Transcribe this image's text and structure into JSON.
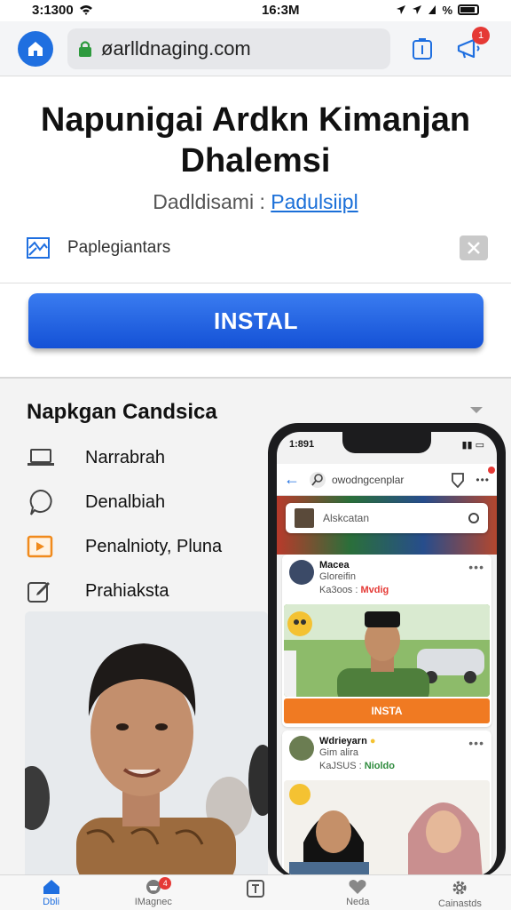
{
  "status_bar": {
    "left_text": "3:1300",
    "time": "16:3M",
    "battery_text": "%"
  },
  "browser": {
    "url": "øarlldnaging.com",
    "notification_count": "1"
  },
  "app": {
    "title": "Napunigai Ardkn Kimanjan Dhalemsi",
    "developer_label": "Dadldisami :",
    "developer_link": "Padulsiipl",
    "ad_label": "Paplegiantars",
    "install_label": "INSTAL"
  },
  "features": {
    "title": "Napkgan Candsica",
    "items": [
      {
        "label": "Narrabrah",
        "icon": "laptop-icon"
      },
      {
        "label": "Denalbiah",
        "icon": "chat-bubble-icon"
      },
      {
        "label": "Penalnioty, Pluna",
        "icon": "play-icon"
      },
      {
        "label": "Prahiaksta",
        "icon": "edit-icon"
      }
    ]
  },
  "phone": {
    "status_time": "1:891",
    "nav_url": "owodngcenplar",
    "search_text": "Alskcatan",
    "posts": [
      {
        "name": "Macea",
        "sub": "Gloreifin",
        "stat": "Ka3oos :",
        "tag": "Mvdig",
        "install_label": "INSTA"
      },
      {
        "name": "Wdrieyarn",
        "sub": "Gim alira",
        "stat": "KaJSUS :",
        "tag": "Nioldo"
      }
    ]
  },
  "bottom_nav": {
    "items": [
      {
        "label": "Dbli",
        "icon": "home-icon"
      },
      {
        "label": "IMagnec",
        "icon": "cart-icon",
        "badge": "4"
      },
      {
        "label": "",
        "icon": "tablet-icon"
      },
      {
        "label": "Neda",
        "icon": "heart-icon"
      },
      {
        "label": "Cainastds",
        "icon": "gear-icon"
      }
    ]
  },
  "colors": {
    "accent": "#1f6fe0",
    "install_button": "#1f5fe0",
    "phone_install": "#f07a22",
    "badge": "#e53935"
  }
}
